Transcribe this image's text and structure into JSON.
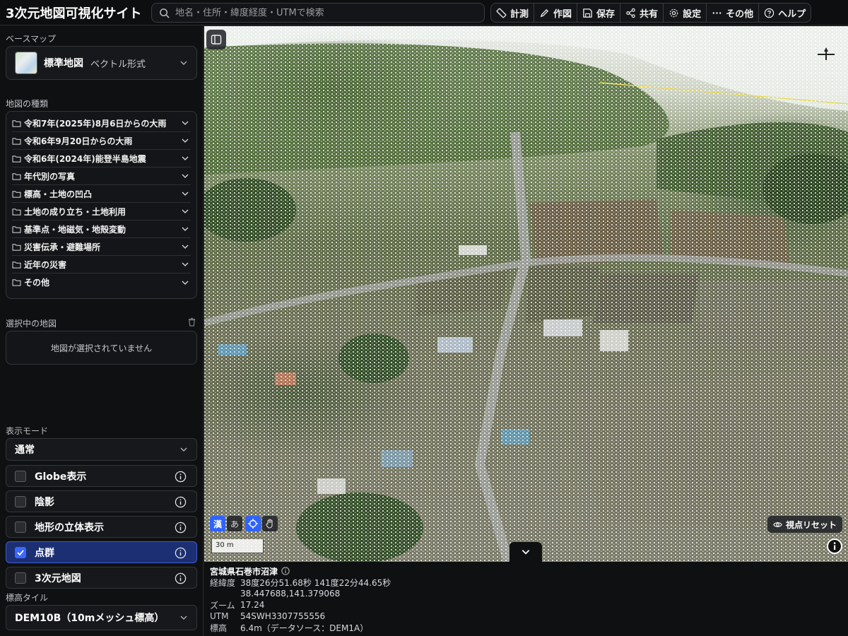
{
  "app": {
    "title": "3次元地図可視化サイト"
  },
  "search": {
    "placeholder": "地名・住所・緯度経度・UTMで検索"
  },
  "toolbar": {
    "measure": "計測",
    "draw": "作図",
    "save": "保存",
    "share": "共有",
    "settings": "設定",
    "more": "その他",
    "help": "ヘルプ"
  },
  "sidebar": {
    "basemap_label": "ベースマップ",
    "basemap": {
      "name": "標準地図",
      "type": "ベクトル形式"
    },
    "types_label": "地図の種類",
    "types": [
      "令和7年(2025年)8月6日からの大雨",
      "令和6年9月20日からの大雨",
      "令和6年(2024年)能登半島地震",
      "年代別の写真",
      "標高・土地の凹凸",
      "土地の成り立ち・土地利用",
      "基準点・地磁気・地殻変動",
      "災害伝承・避難場所",
      "近年の災害",
      "その他"
    ],
    "selected_label": "選択中の地図",
    "selected_empty": "地図が選択されていません",
    "mode_label": "表示モード",
    "mode_value": "通常",
    "toggles": [
      {
        "label": "Globe表示",
        "checked": false
      },
      {
        "label": "陰影",
        "checked": false
      },
      {
        "label": "地形の立体表示",
        "checked": false
      },
      {
        "label": "点群",
        "checked": true
      },
      {
        "label": "3次元地図",
        "checked": false
      }
    ],
    "elev_label": "標高タイル",
    "elev_value": "DEM10B（10mメッシュ標高）"
  },
  "map": {
    "lang_kanji": "漢",
    "lang_kana": "あ",
    "scale": "30 m",
    "reset_label": "視点リセット"
  },
  "status": {
    "place": "宮城県石巻市沼津",
    "lonlat_label": "経緯度",
    "lonlat_dms": "38度26分51.68秒 141度22分44.65秒",
    "lonlat_dec": "38.447688,141.379068",
    "zoom_label": "ズーム",
    "zoom": "17.24",
    "utm_label": "UTM",
    "utm": "54SWH3307755556",
    "elev_label": "標高",
    "elev": "6.4m（データソース：DEM1A）"
  },
  "colors": {
    "accent": "#2f63ff",
    "active_row": "#1c2f73",
    "bg": "#0f1012"
  }
}
